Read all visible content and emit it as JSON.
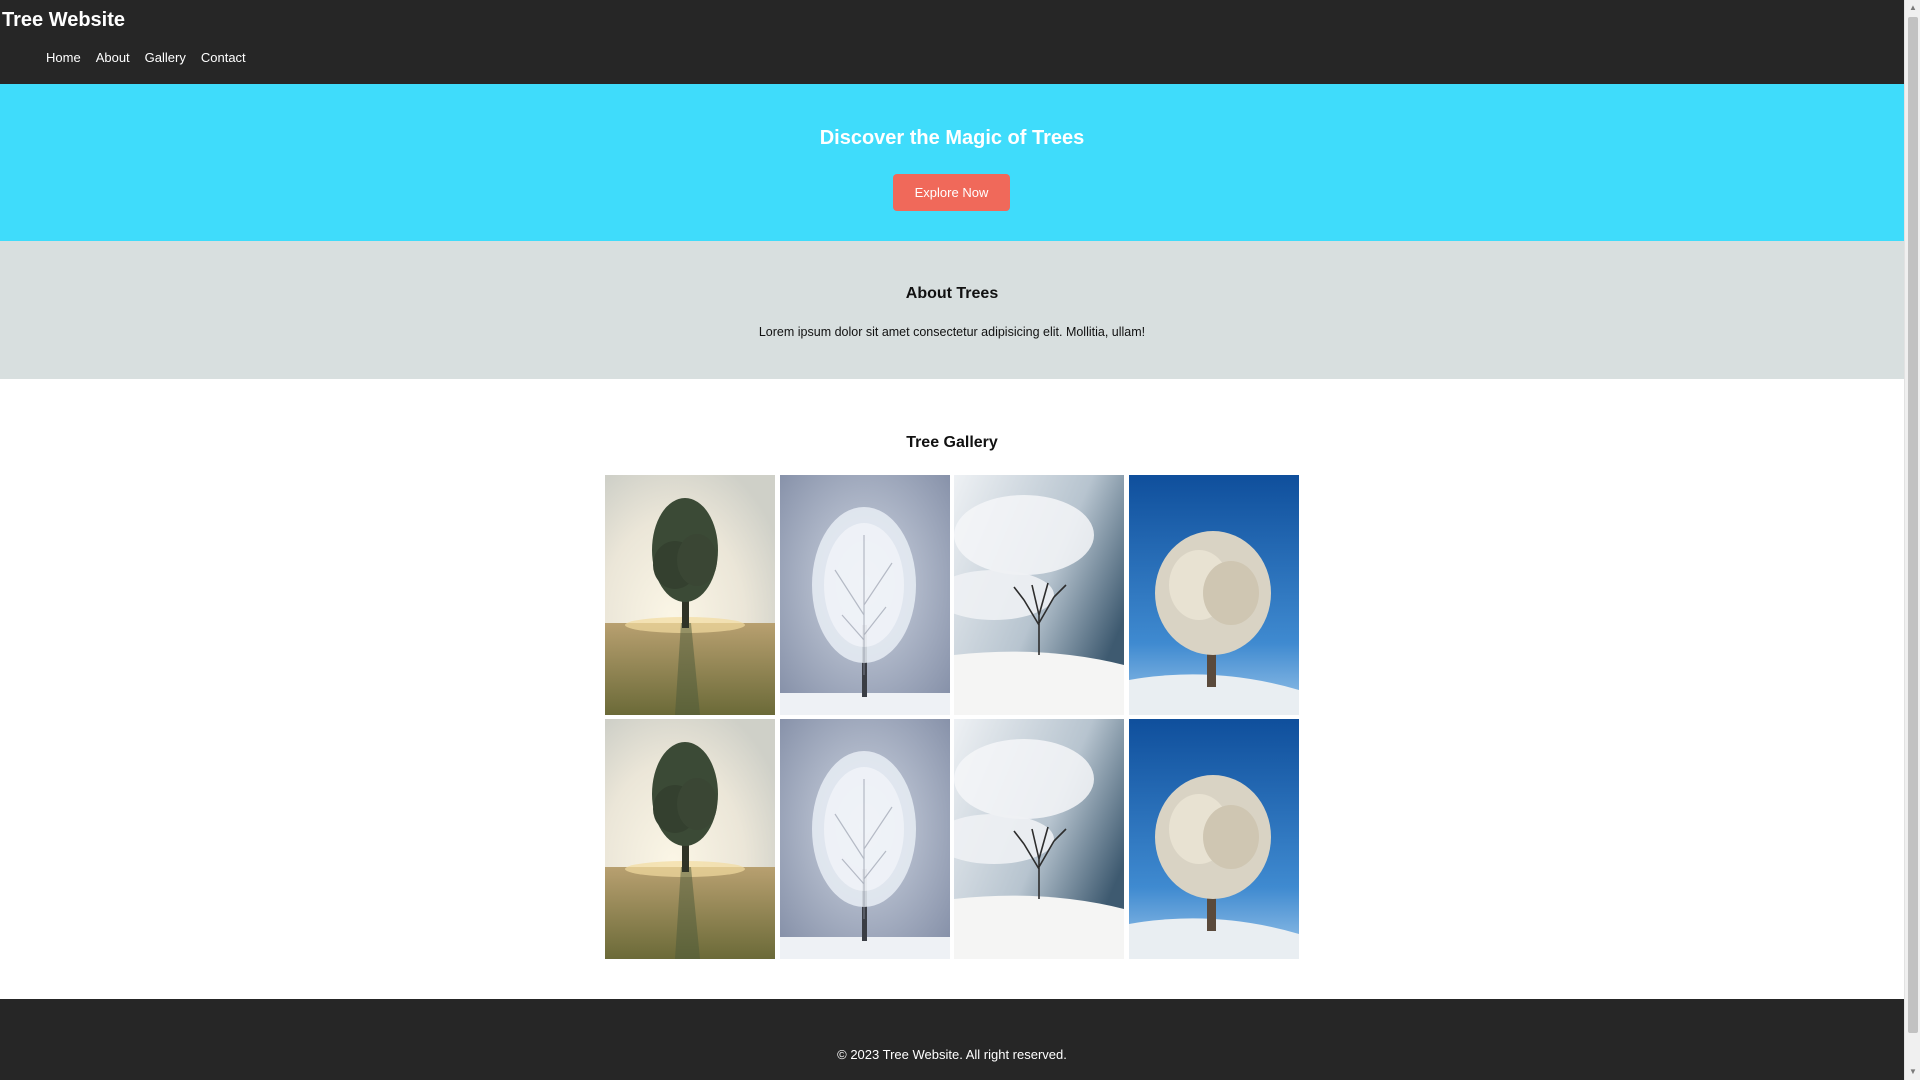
{
  "header": {
    "site_title": "Tree Website",
    "nav": [
      "Home",
      "About",
      "Gallery",
      "Contact"
    ]
  },
  "hero": {
    "title": "Discover the Magic of Trees",
    "button_label": "Explore Now"
  },
  "about": {
    "title": "About Trees",
    "text": "Lorem ipsum dolor sit amet consectetur adipisicing elit. Mollitia, ullam!"
  },
  "gallery": {
    "title": "Tree Gallery",
    "images": [
      "sunset-field-tree",
      "frosted-tree-grey-sky",
      "bare-tree-snow-clouds",
      "frosted-tree-blue-sky",
      "sunset-field-tree",
      "frosted-tree-grey-sky",
      "bare-tree-snow-clouds",
      "frosted-tree-blue-sky"
    ]
  },
  "footer": {
    "text": "© 2023 Tree Website. All right reserved."
  },
  "colors": {
    "header_bg": "#262626",
    "hero_bg": "#3fdcfb",
    "button_bg": "#f0695a",
    "about_bg": "#d8dfdf"
  }
}
